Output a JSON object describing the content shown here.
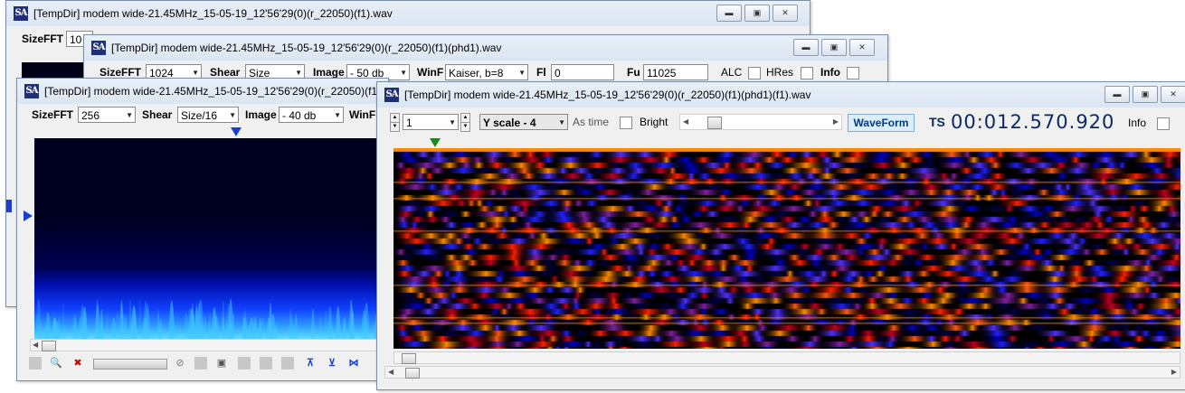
{
  "window1": {
    "title": "[TempDir] modem wide-21.45MHz_15-05-19_12'56'29(0)(r_22050)(f1).wav",
    "sizefft_label": "SizeFFT",
    "sizefft_value": "10"
  },
  "window2": {
    "title": "[TempDir] modem wide-21.45MHz_15-05-19_12'56'29(0)(r_22050)(f1)(phd1).wav",
    "sizefft_label": "SizeFFT",
    "sizefft_value": "1024",
    "shear_label": "Shear",
    "shear_value": "Size",
    "image_label": "Image",
    "image_value": "- 50 db",
    "winf_label": "WinF",
    "winf_value": "Kaiser, b=8",
    "fl_label": "Fl",
    "fl_value": "0",
    "fu_label": "Fu",
    "fu_value": "11025",
    "alc_label": "ALC",
    "hres_label": "HRes",
    "info_label": "Info"
  },
  "window3": {
    "title": "[TempDir] modem wide-21.45MHz_15-05-19_12'56'29(0)(r_22050)(f1)(",
    "sizefft_label": "SizeFFT",
    "sizefft_value": "256",
    "shear_label": "Shear",
    "shear_value": "Size/16",
    "image_label": "Image",
    "image_value": "- 40 db",
    "winf_label": "WinF"
  },
  "window4": {
    "title": "[TempDir] modem wide-21.45MHz_15-05-19_12'56'29(0)(r_22050)(f1)(phd1)(f1).wav",
    "channel_value": "1",
    "yscale_value": "Y scale - 4",
    "astime_label": "As time",
    "bright_label": "Bright",
    "waveform_label": "WaveForm",
    "ts_label": "TS",
    "ts_value": "00:012.570.920",
    "info_label": "Info"
  },
  "colors": {
    "waveform_button_bg": "#dbeefc",
    "marker_blue": "#1a3fd0",
    "marker_green": "#1a8a1a",
    "accent_orange": "#ff8a00"
  },
  "icons": {
    "window_minimize": "minimize-icon",
    "window_maximize": "maximize-icon",
    "window_close": "close-icon"
  }
}
